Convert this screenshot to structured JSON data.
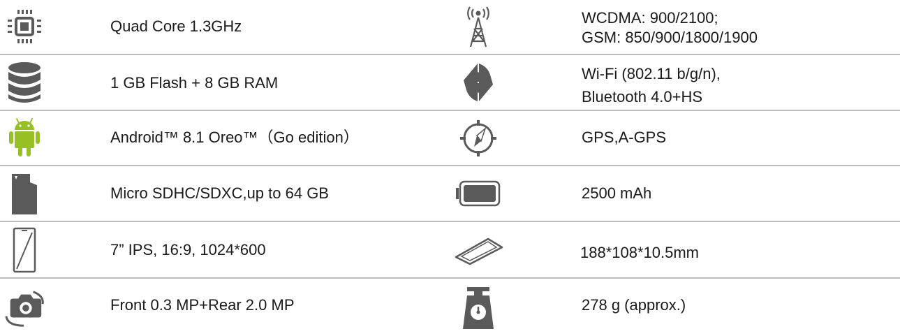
{
  "specs": [
    {
      "left": {
        "icon": "cpu-chip-icon",
        "text": "Quad Core 1.3GHz"
      },
      "right": {
        "icon": "cell-tower-icon",
        "text_line1": "WCDMA: 900/2100;",
        "text_line2": "GSM: 850/900/1800/1900"
      }
    },
    {
      "left": {
        "icon": "storage-stack-icon",
        "text": "1 GB Flash + 8 GB RAM"
      },
      "right": {
        "icon": "wireless-arrows-icon",
        "text_line1": "Wi-Fi (802.11 b/g/n),",
        "text_line2": "Bluetooth 4.0+HS"
      }
    },
    {
      "left": {
        "icon": "android-robot-icon",
        "text": "Android™ 8.1 Oreo™（Go edition）"
      },
      "right": {
        "icon": "compass-icon",
        "text": "GPS,A-GPS"
      }
    },
    {
      "left": {
        "icon": "memory-card-icon",
        "text": "Micro SDHC/SDXC,up to 64 GB"
      },
      "right": {
        "icon": "battery-icon",
        "text": "2500 mAh"
      }
    },
    {
      "left": {
        "icon": "phone-screen-icon",
        "text": "7” IPS, 16:9, 1024*600"
      },
      "right": {
        "icon": "device-dimensions-icon",
        "text": "188*108*10.5mm"
      }
    },
    {
      "left": {
        "icon": "rotate-camera-icon",
        "text": "Front 0.3 MP+Rear 2.0 MP"
      },
      "right": {
        "icon": "weight-scale-icon",
        "text": "278 g (approx.)"
      }
    }
  ],
  "colors": {
    "icon_gray": "#5a5a5a",
    "android_green": "#97c024",
    "separator": "#bdbdbd"
  }
}
